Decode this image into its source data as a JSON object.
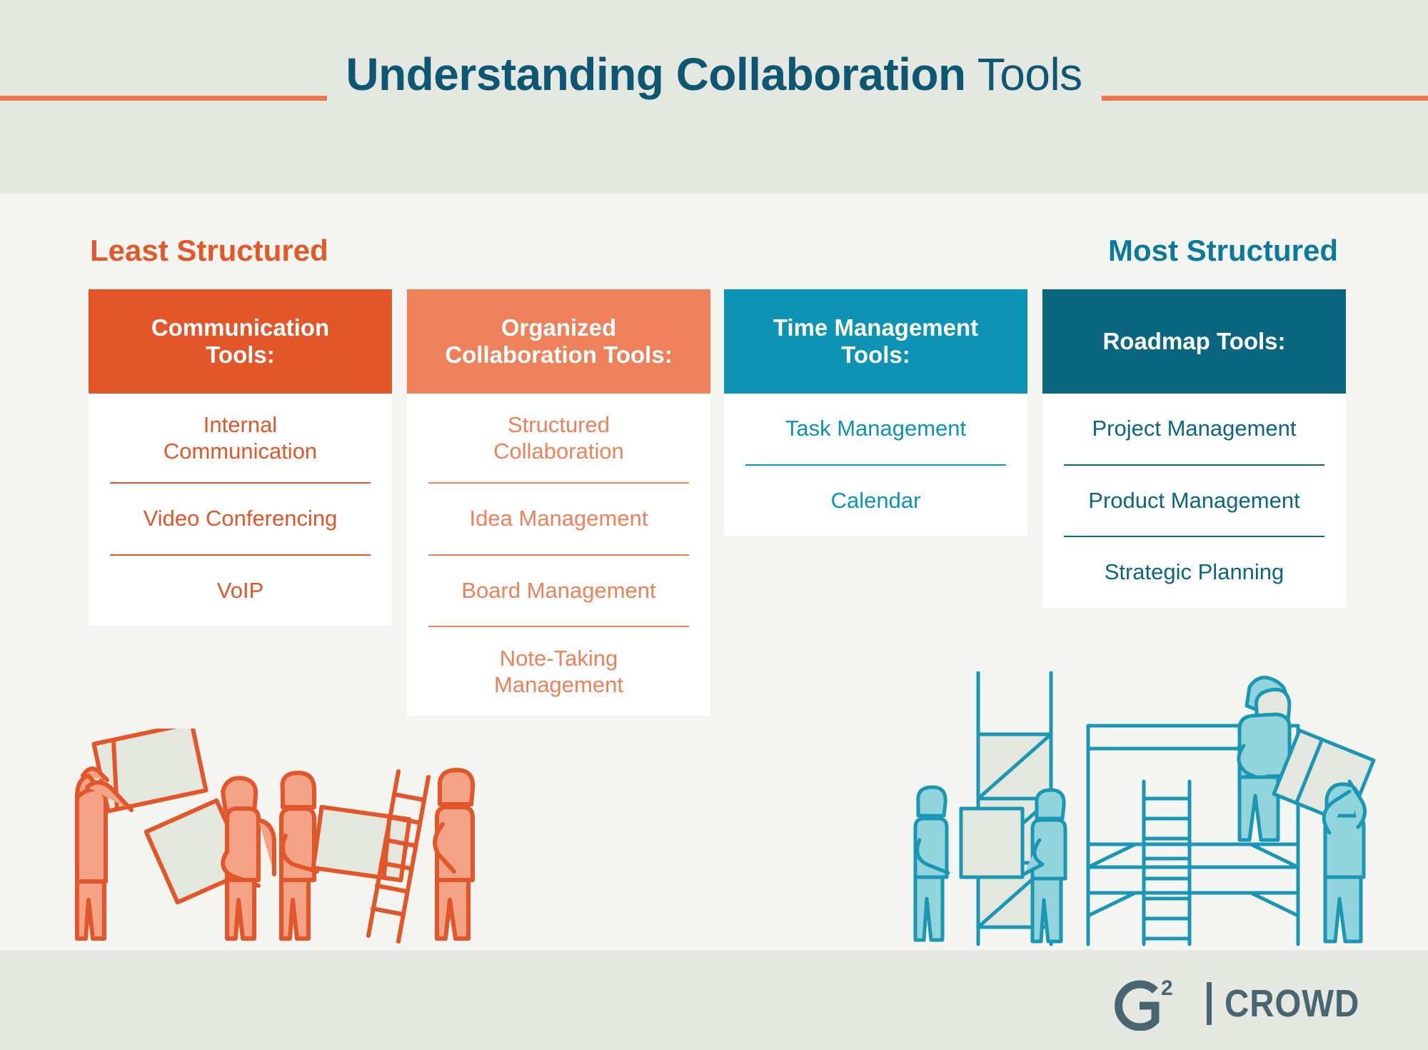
{
  "header": {
    "title_bold": "Understanding Collaboration",
    "title_light": " Tools",
    "band_color": "#E5E8E0"
  },
  "scale": {
    "least_label": "Least Structured",
    "least_color": "#E35728",
    "most_label": "Most Structured",
    "most_color": "#0C7A9B"
  },
  "columns": [
    {
      "header": "Communication Tools:",
      "header_line1": "Communication",
      "header_line2": "Tools:",
      "header_color": "#E2562A",
      "text_color": "#E2562A",
      "items": [
        "Internal Communication",
        "Video Conferencing",
        "VoIP"
      ]
    },
    {
      "header": "Organized Collaboration Tools:",
      "header_line1": "Organized",
      "header_line2": "Collaboration Tools:",
      "header_color": "#EE8159",
      "text_color": "#EE8159",
      "items": [
        "Structured Collaboration",
        "Idea Management",
        "Board Management",
        "Note-Taking Management"
      ]
    },
    {
      "header": "Time Management Tools:",
      "header_line1": "Time Management",
      "header_line2": "Tools:",
      "header_color": "#0D93B4",
      "text_color": "#0D93B4",
      "items": [
        "Task Management",
        "Calendar"
      ]
    },
    {
      "header": "Roadmap Tools:",
      "header_line1": "Roadmap Tools:",
      "header_line2": "",
      "header_color": "#0B6680",
      "text_color": "#0B6680",
      "items": [
        "Project Management",
        "Product Management",
        "Strategic Planning"
      ]
    }
  ],
  "items": {
    "c1_i1_l1": "Internal",
    "c1_i1_l2": "Communication",
    "c1_i2": "Video Conferencing",
    "c1_i3": "VoIP",
    "c2_i1_l1": "Structured",
    "c2_i1_l2": "Collaboration",
    "c2_i2": "Idea Management",
    "c2_i3": "Board Management",
    "c2_i4_l1": "Note-Taking",
    "c2_i4_l2": "Management",
    "c3_i1": "Task Management",
    "c3_i2": "Calendar",
    "c4_i1": "Project Management",
    "c4_i2": "Product Management",
    "c4_i3": "Strategic Planning"
  },
  "footer": {
    "logo_g2": "G2",
    "logo_superscript": "2",
    "logo_word": "CROWD",
    "logo_color": "#4A6572",
    "band_color": "#E5E8E0"
  },
  "illustrations": {
    "left_name": "orange-workers-carrying-panels",
    "left_stroke": "#E2562A",
    "left_fill": "#F4A387",
    "right_name": "teal-workers-scaffolding",
    "right_stroke": "#1A97B4",
    "right_fill": "#92D4DC",
    "panel_fill": "#E3E7DD"
  },
  "canvas": {
    "background": "#F4F5F0"
  }
}
